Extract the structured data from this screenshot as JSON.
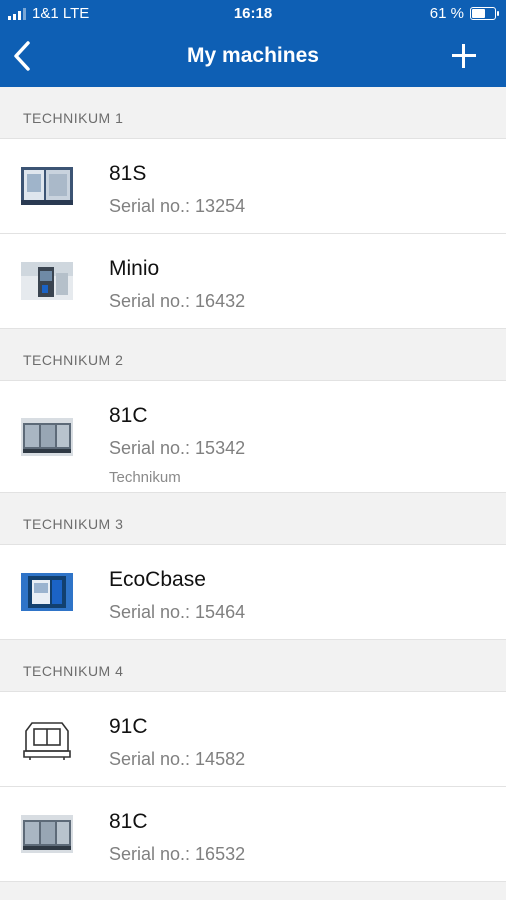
{
  "status": {
    "carrier": "1&1 LTE",
    "time": "16:18",
    "battery": "61 %",
    "battery_level": 0.61
  },
  "header": {
    "title": "My machines"
  },
  "sections": [
    {
      "label": "TECHNIKUM 1",
      "items": [
        {
          "name": "81S",
          "serial": "Serial no.: 13254",
          "icon": "machine-81s-thumbnail"
        },
        {
          "name": "Minio",
          "serial": "Serial no.: 16432",
          "icon": "machine-minio-thumbnail"
        }
      ]
    },
    {
      "label": "TECHNIKUM 2",
      "items": [
        {
          "name": "81C",
          "serial": "Serial no.: 15342",
          "location": "Technikum",
          "icon": "machine-81c-thumbnail"
        }
      ]
    },
    {
      "label": "TECHNIKUM 3",
      "items": [
        {
          "name": "EcoCbase",
          "serial": "Serial no.: 15464",
          "icon": "machine-ecocbase-thumbnail"
        }
      ]
    },
    {
      "label": "TECHNIKUM 4",
      "items": [
        {
          "name": "91C",
          "serial": "Serial no.: 14582",
          "icon": "machine-91c-outline-thumbnail"
        },
        {
          "name": "81C",
          "serial": "Serial no.: 16532",
          "icon": "machine-81c-thumbnail"
        }
      ]
    }
  ],
  "colors": {
    "header_bg": "#0e5fb4",
    "section_bg": "#f2f2f2",
    "accent_blue": "#1b63c6"
  }
}
